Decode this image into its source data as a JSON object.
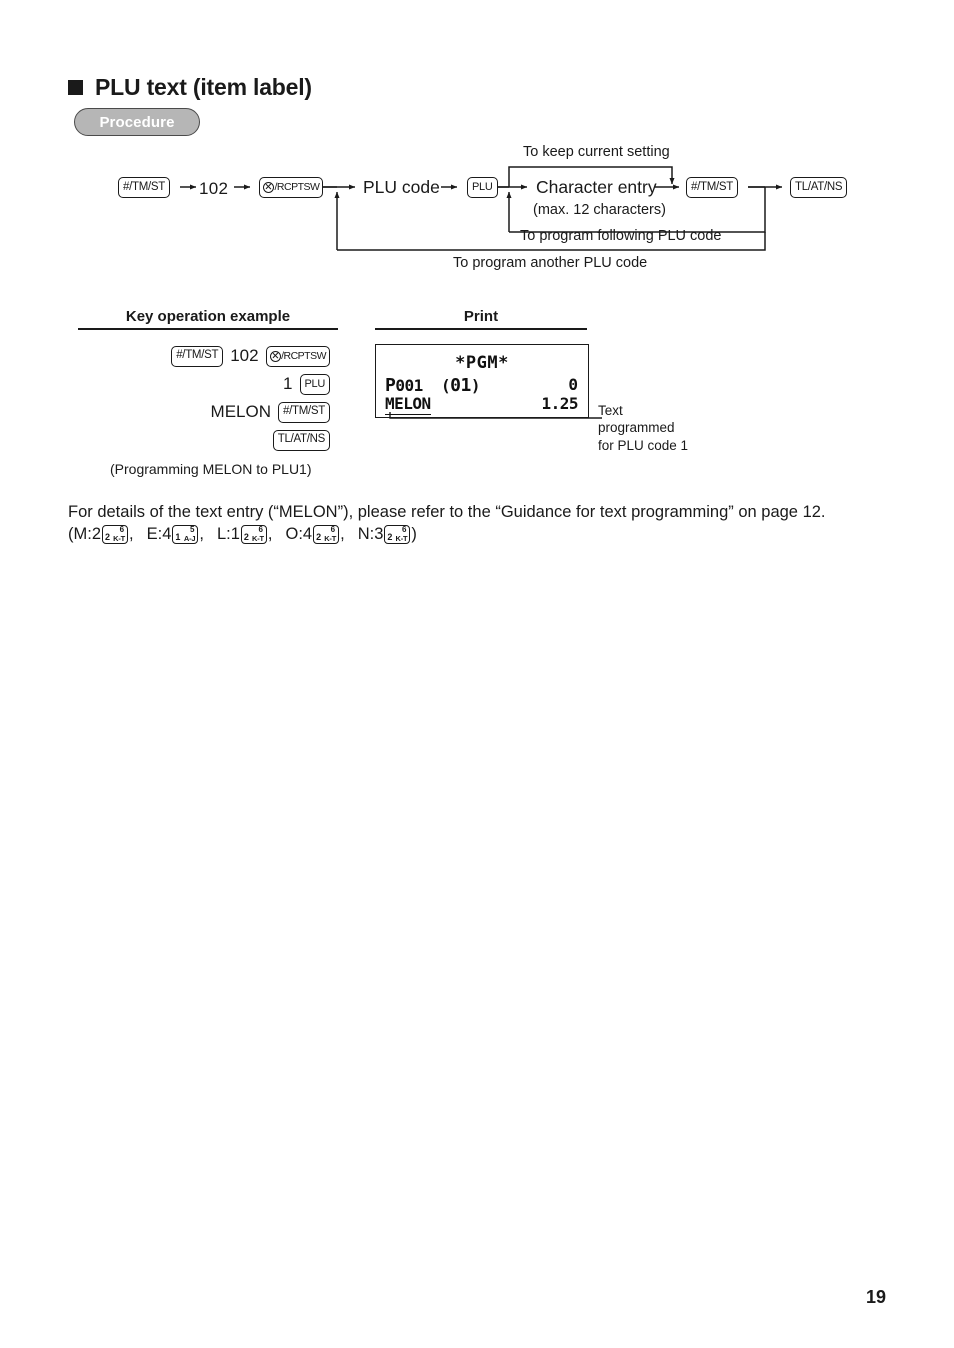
{
  "heading": {
    "bullet": "square-bullet",
    "title": "PLU text (item label)",
    "procedure_label": "Procedure"
  },
  "flow": {
    "keys": {
      "tmst": "#/TM/ST",
      "rcptsw": "/RCPTSW",
      "plu": "PLU",
      "tlatns": "TL/AT/NS"
    },
    "code": "102",
    "plu_code_label": "PLU code",
    "character_entry_label": "Character entry",
    "character_entry_note": "(max. 12 characters)",
    "keep_current_setting": "To keep current setting",
    "program_following": "To program following PLU code",
    "program_another": "To program another PLU code"
  },
  "columns": {
    "key_operation_header": "Key operation example",
    "print_header": "Print"
  },
  "key_operation": {
    "rows": [
      {
        "key_left": "#/TM/ST",
        "literal": "102",
        "key_right": "/RCPTSW"
      },
      {
        "literal": "1",
        "key_right": "PLU"
      },
      {
        "literal": "MELON",
        "key_right": "#/TM/ST"
      },
      {
        "key_right": "TL/AT/NS"
      }
    ],
    "note": "(Programming MELON to PLU1)"
  },
  "receipt": {
    "title": "*PGM*",
    "line1_left_bold": "P",
    "line1_left_rest": "001",
    "line1_mid_open": "(",
    "line1_mid_val": "01",
    "line1_mid_close": ")",
    "line1_right": "0",
    "line2_left": "MELON",
    "line2_right": "1.25",
    "annotation": "Text\nprogrammed\nfor PLU code 1",
    "annotation_lines": [
      "Text",
      "programmed",
      "for PLU code 1"
    ]
  },
  "paragraph": {
    "line1": "For details of the text entry (“MELON”), please refer to the “Guidance for text programming” on page 12.",
    "open_paren": "(",
    "close_paren": ")",
    "entries": [
      {
        "label": "M:2",
        "digit": "2",
        "range": "K-T",
        "sup": "6",
        "sep": ","
      },
      {
        "label": "E:4",
        "digit": "1",
        "range": "A-J",
        "sup": "5",
        "sep": ","
      },
      {
        "label": "L:1",
        "digit": "2",
        "range": "K-T",
        "sup": "6",
        "sep": ","
      },
      {
        "label": "O:4",
        "digit": "2",
        "range": "K-T",
        "sup": "6",
        "sep": ","
      },
      {
        "label": "N:3",
        "digit": "2",
        "range": "K-T",
        "sup": "6",
        "sep": ""
      }
    ]
  },
  "footer": {
    "page_number": "19"
  },
  "colors": {
    "ink": "#1a1a1a",
    "procedure_fill": "#b6b6b6",
    "procedure_border": "#4a4a4a",
    "paper": "#ffffff"
  }
}
